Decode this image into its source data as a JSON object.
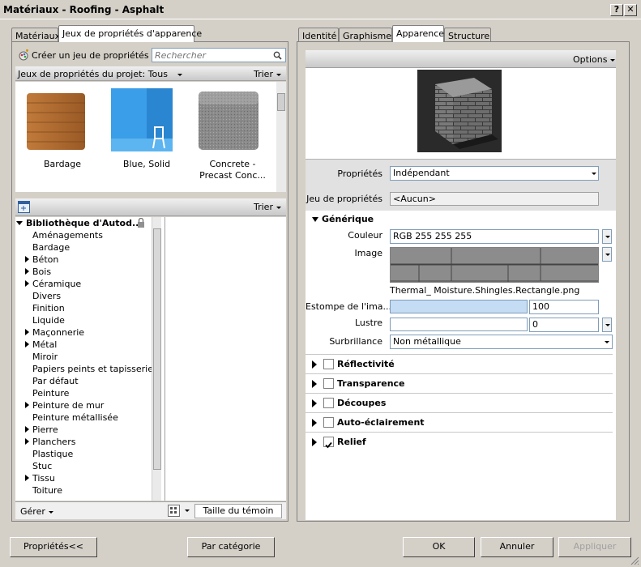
{
  "window": {
    "title": "Matériaux - Roofing - Asphalt",
    "help": "?",
    "close": "✕"
  },
  "left_tabs": [
    "Matériaux",
    "Jeux de propriétés d'apparence"
  ],
  "toolbar": {
    "create": "Créer un jeu de propriétés",
    "search_placeholder": "Rechercher"
  },
  "project_bar": {
    "label": "Jeux de propriétés du projet: Tous",
    "sort": "Trier"
  },
  "thumbnails": [
    {
      "label": "Bardage"
    },
    {
      "label": "Blue, Solid"
    },
    {
      "label": "Concrete -\nPrecast Conc..."
    }
  ],
  "lib_bar": {
    "sort": "Trier"
  },
  "library": {
    "root": "Bibliothèque d'Autod...",
    "items": [
      {
        "label": "Aménagements",
        "expandable": false
      },
      {
        "label": "Bardage",
        "expandable": false
      },
      {
        "label": "Béton",
        "expandable": true
      },
      {
        "label": "Bois",
        "expandable": true
      },
      {
        "label": "Céramique",
        "expandable": true
      },
      {
        "label": "Divers",
        "expandable": false
      },
      {
        "label": "Finition",
        "expandable": false
      },
      {
        "label": "Liquide",
        "expandable": false
      },
      {
        "label": "Maçonnerie",
        "expandable": true
      },
      {
        "label": "Métal",
        "expandable": true
      },
      {
        "label": "Miroir",
        "expandable": false
      },
      {
        "label": "Papiers peints et tapisseries",
        "expandable": false
      },
      {
        "label": "Par défaut",
        "expandable": false
      },
      {
        "label": "Peinture",
        "expandable": false
      },
      {
        "label": "Peinture de mur",
        "expandable": true
      },
      {
        "label": "Peinture métallisée",
        "expandable": false
      },
      {
        "label": "Pierre",
        "expandable": true
      },
      {
        "label": "Planchers",
        "expandable": true
      },
      {
        "label": "Plastique",
        "expandable": false
      },
      {
        "label": "Stuc",
        "expandable": false
      },
      {
        "label": "Tissu",
        "expandable": true
      },
      {
        "label": "Toiture",
        "expandable": false
      }
    ]
  },
  "left_footer": {
    "manage": "Gérer",
    "swatch_size": "Taille du témoin"
  },
  "right_tabs": [
    "Identité",
    "Graphismes",
    "Apparence",
    "Structure"
  ],
  "options": "Options",
  "props": {
    "proprietes_label": "Propriétés",
    "proprietes_value": "Indépendant",
    "jeu_label": "Jeu de propriétés",
    "jeu_value": "<Aucun>"
  },
  "generique": {
    "title": "Générique",
    "couleur_label": "Couleur",
    "couleur_value": "RGB 255 255 255",
    "image_label": "Image",
    "image_file": "Thermal_ Moisture.Shingles.Rectangle.png",
    "estompe_label": "Estompe de l'ima...",
    "estompe_value": "100",
    "lustre_label": "Lustre",
    "lustre_value": "0",
    "surbrillance_label": "Surbrillance",
    "surbrillance_value": "Non métallique"
  },
  "sections": [
    {
      "label": "Réflectivité",
      "checked": false
    },
    {
      "label": "Transparence",
      "checked": false
    },
    {
      "label": "Découpes",
      "checked": false
    },
    {
      "label": "Auto-éclairement",
      "checked": false
    },
    {
      "label": "Relief",
      "checked": true
    }
  ],
  "bottom": {
    "props": "Propriétés<<",
    "category": "Par catégorie",
    "ok": "OK",
    "cancel": "Annuler",
    "apply": "Appliquer"
  }
}
